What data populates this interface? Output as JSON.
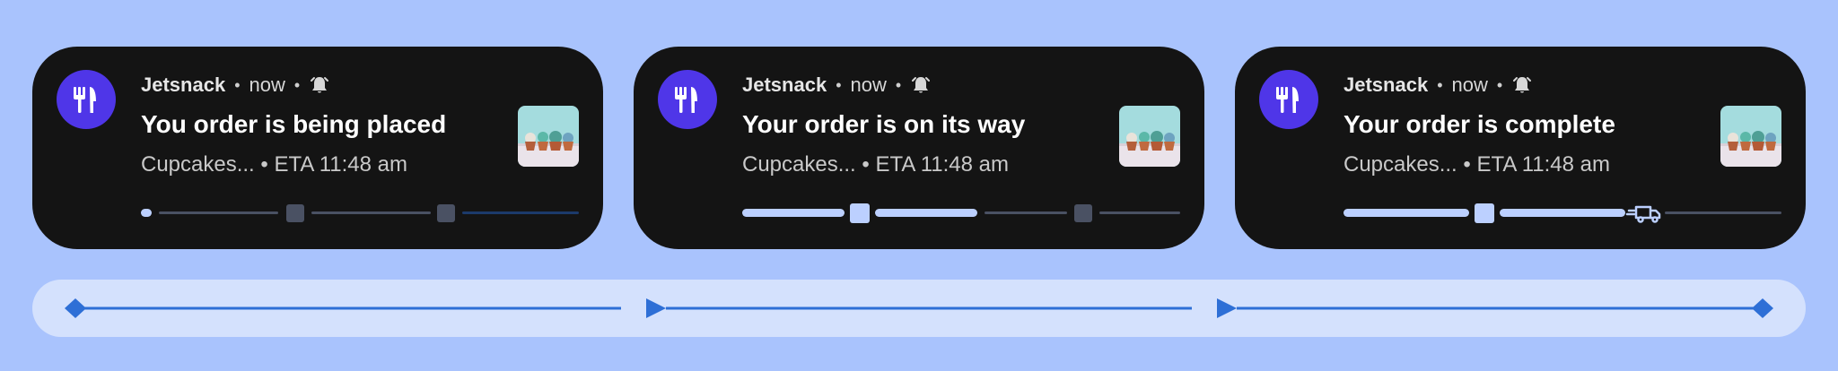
{
  "notifications": [
    {
      "app_name": "Jetsnack",
      "time": "now",
      "separator": "•",
      "title": "You order is being placed",
      "subtitle": "Cupcakes... • ETA 11:48 am",
      "progress_fraction": 0.0
    },
    {
      "app_name": "Jetsnack",
      "time": "now",
      "separator": "•",
      "title": "Your order is on its way",
      "subtitle": "Cupcakes... • ETA 11:48 am",
      "progress_fraction": 0.54
    },
    {
      "app_name": "Jetsnack",
      "time": "now",
      "separator": "•",
      "title": "Your order is complete",
      "subtitle": "Cupcakes... • ETA 11:48 am",
      "progress_fraction": 0.72
    }
  ],
  "icons": {
    "app": "fork-knife-icon",
    "alert": "alarm-bell-icon",
    "truck": "delivery-truck-icon",
    "thumbnail": "cupcakes-image"
  },
  "colors": {
    "background": "#a9c3fd",
    "card": "#141414",
    "app_icon": "#4f36e8",
    "progress_filled": "#bcd0ff",
    "progress_empty": "#4a5163",
    "timeline_bg": "#d4e1fd",
    "timeline_accent": "#2e6fd6"
  }
}
